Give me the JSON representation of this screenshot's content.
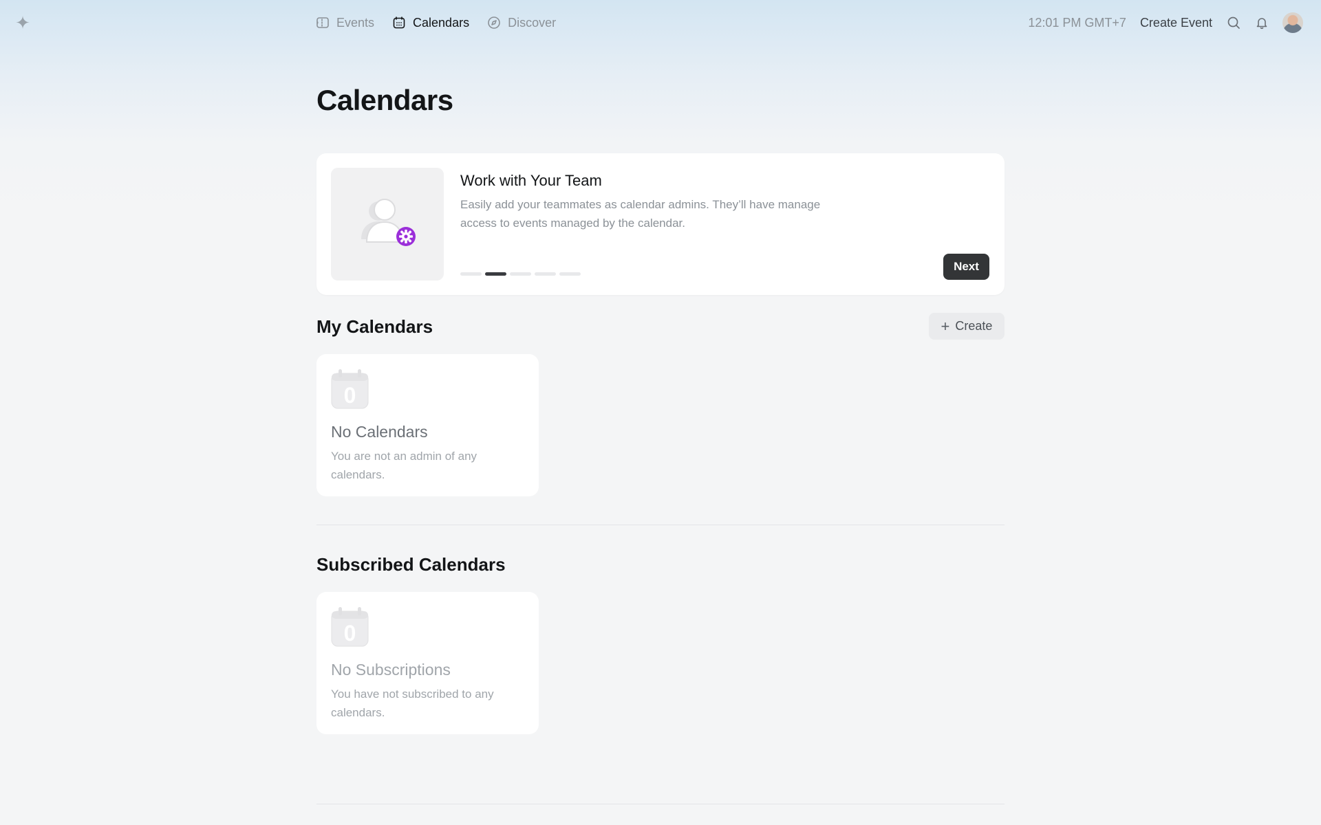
{
  "nav": {
    "items": [
      {
        "label": "Events",
        "icon": "ticket-icon",
        "active": false
      },
      {
        "label": "Calendars",
        "icon": "calendar-icon",
        "active": true
      },
      {
        "label": "Discover",
        "icon": "compass-icon",
        "active": false
      }
    ]
  },
  "header": {
    "time": "12:01 PM GMT+7",
    "create_event": "Create Event",
    "icons": [
      "search-icon",
      "bell-icon"
    ]
  },
  "page": {
    "title": "Calendars"
  },
  "promo": {
    "title": "Work with Your Team",
    "description": "Easily add your teammates as calendar admins. They’ll have manage access to events managed by the calendar.",
    "step": 2,
    "total_steps": 5,
    "next_label": "Next",
    "accent_color": "#9b2fd9"
  },
  "my_calendars": {
    "title": "My Calendars",
    "create_label": "Create",
    "empty_title": "No Calendars",
    "empty_desc": "You are not an admin of any calendars.",
    "count": "0"
  },
  "subscribed": {
    "title": "Subscribed Calendars",
    "empty_title": "No Subscriptions",
    "empty_desc": "You have not subscribed to any calendars.",
    "count": "0"
  }
}
